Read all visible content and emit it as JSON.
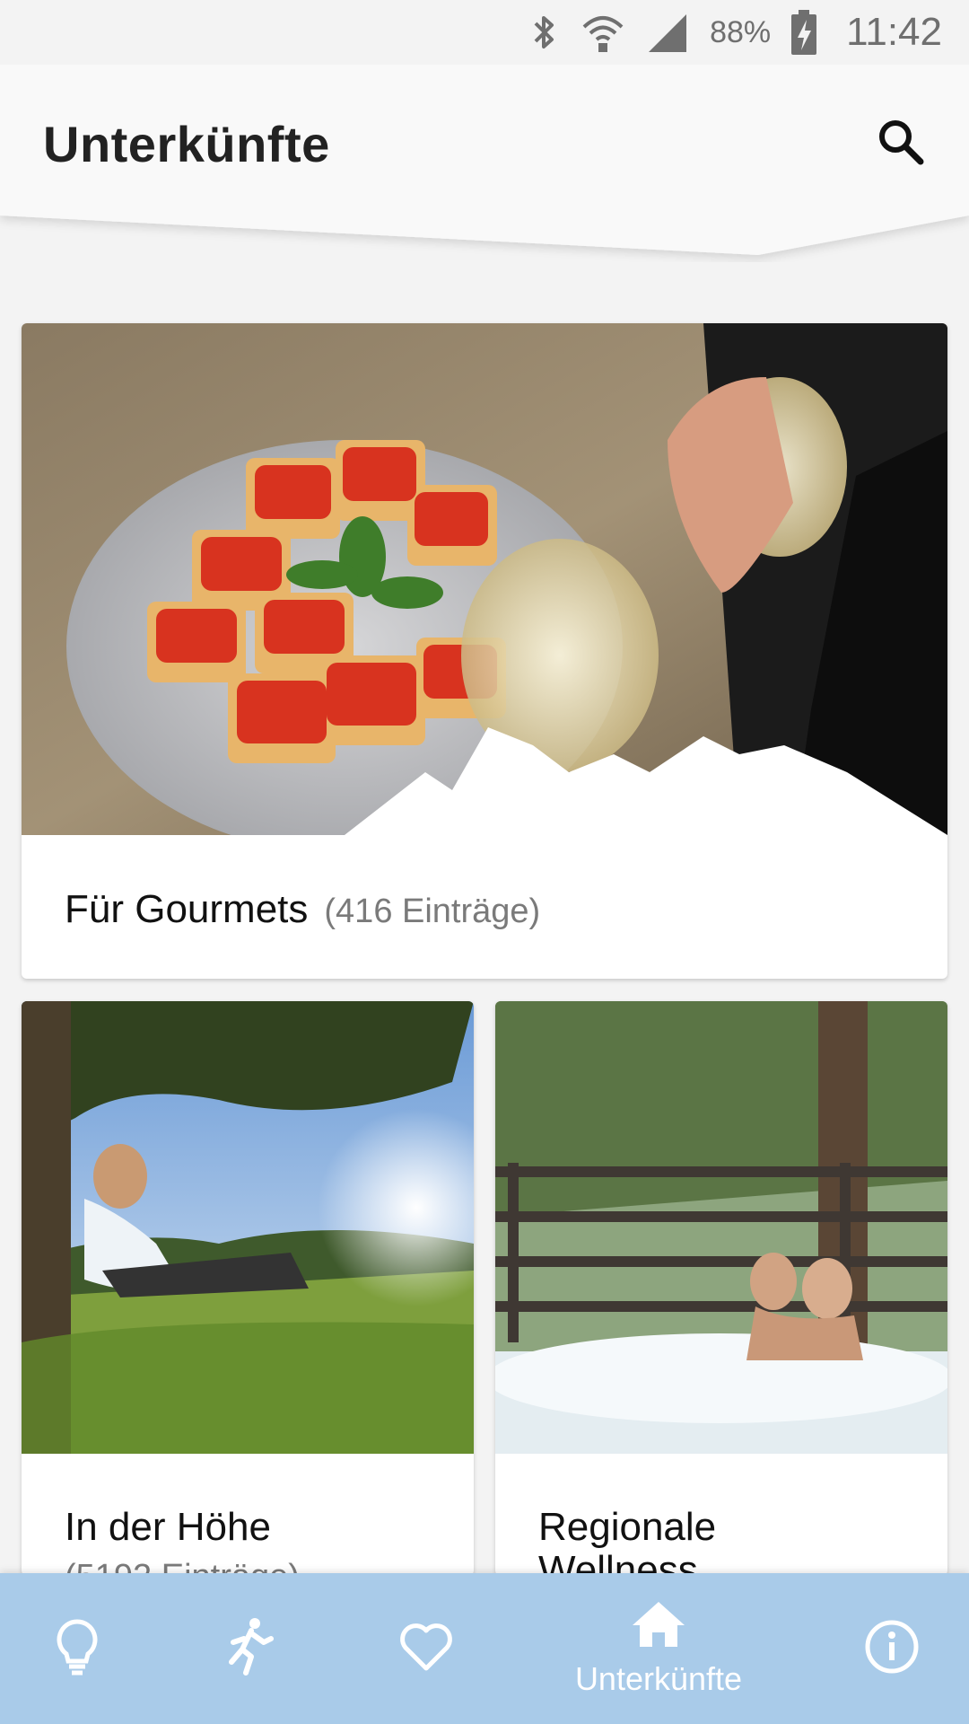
{
  "status_bar": {
    "battery_percent": "88%",
    "time": "11:42",
    "icons": [
      "bluetooth-icon",
      "wifi-icon",
      "signal-icon",
      "battery-charging-icon"
    ]
  },
  "header": {
    "title": "Unterkünfte",
    "search_icon": "search-icon"
  },
  "cards": [
    {
      "title": "Für Gourmets",
      "count": "(416 Einträge)",
      "image": "gourmet-food-wine-photo"
    },
    {
      "title": "In der Höhe",
      "count": "(5192 Einträge)",
      "image": "mountain-meadow-rest-photo"
    },
    {
      "title": "Regionale",
      "title_line2": "Wellness",
      "image": "outdoor-hot-tub-photo"
    }
  ],
  "bottom_nav": {
    "items": [
      {
        "icon": "lightbulb-icon",
        "label": ""
      },
      {
        "icon": "running-person-icon",
        "label": ""
      },
      {
        "icon": "heart-icon",
        "label": ""
      },
      {
        "icon": "home-icon",
        "label": "Unterkünfte",
        "active": true
      },
      {
        "icon": "info-icon",
        "label": ""
      }
    ]
  },
  "colors": {
    "nav_background": "#a9cbe9",
    "page_background": "#f3f3f3",
    "card_background": "#ffffff"
  }
}
